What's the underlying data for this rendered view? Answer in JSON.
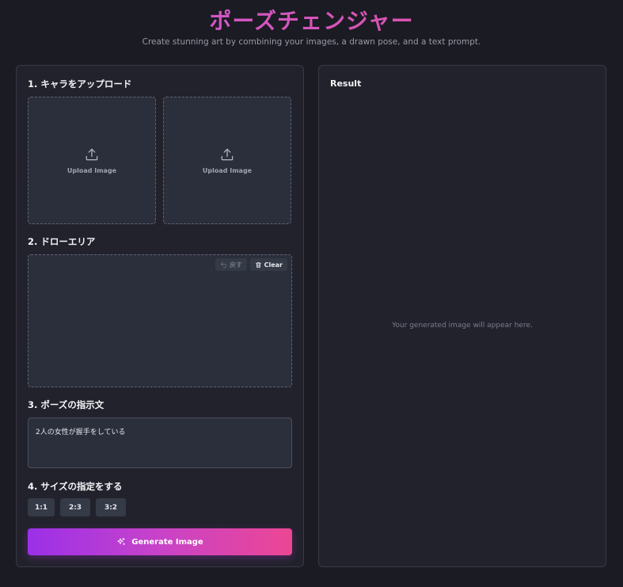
{
  "header": {
    "title": "ポーズチェンジャー",
    "subtitle": "Create stunning art by combining your images, a drawn pose, and a text prompt."
  },
  "upload": {
    "section_title": "1. キャラをアップロード",
    "slots": [
      {
        "label": "Upload Image",
        "icon": "upload-icon"
      },
      {
        "label": "Upload Image",
        "icon": "upload-icon"
      }
    ]
  },
  "draw": {
    "section_title": "2. ドローエリア",
    "undo_label": "戻す",
    "clear_label": "Clear"
  },
  "prompt": {
    "section_title": "3. ポーズの指示文",
    "value": "2人の女性が握手をしている"
  },
  "size": {
    "section_title": "4. サイズの指定をする",
    "options": [
      "1:1",
      "2:3",
      "3:2"
    ]
  },
  "generate": {
    "label": "Generate Image",
    "icon": "sparkles-icon"
  },
  "result": {
    "title": "Result",
    "placeholder": "Your generated image will appear here."
  },
  "colors": {
    "background": "#1b1b23",
    "panel": "#22222c",
    "accent_start": "#9b30e8",
    "accent_end": "#ec4693"
  }
}
